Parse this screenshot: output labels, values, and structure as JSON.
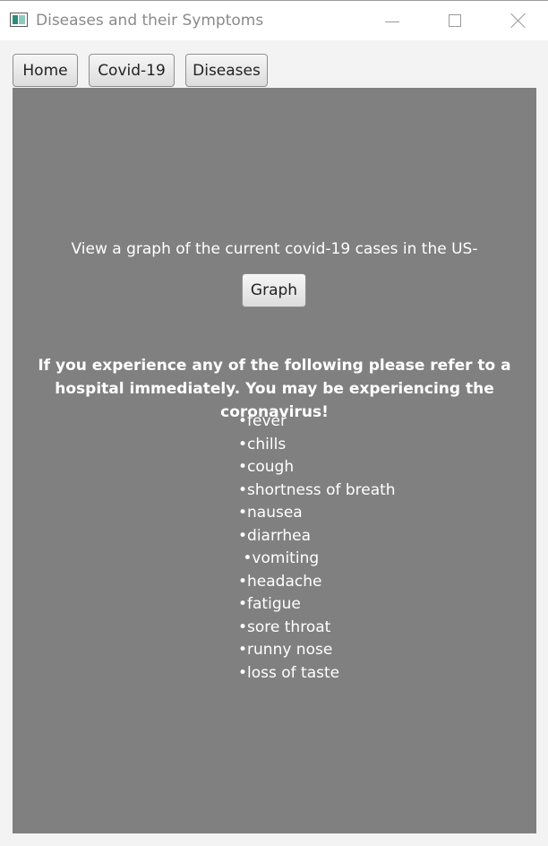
{
  "window": {
    "title": "Diseases and their Symptoms",
    "icon": "app-icon",
    "controls": [
      "minimize-icon",
      "maximize-icon",
      "close-icon"
    ]
  },
  "nav": {
    "home": "Home",
    "covid": "Covid-19",
    "diseases": "Diseases"
  },
  "main": {
    "graph_prompt": "View a graph of the current covid-19 cases in the US-",
    "graph_button": "Graph",
    "warning": "If you experience any of the following please refer to a hospital immediately. You may be experiencing the coronavirus!",
    "symptoms": [
      "•fever",
      "•chills",
      "•cough",
      "•shortness of breath",
      "•nausea",
      "•diarrhea",
      " •vomiting",
      "•headache",
      "•fatigue",
      "•sore throat",
      "•runny nose",
      "•loss of taste"
    ]
  },
  "colors": {
    "panel": "#808080",
    "window_bg": "#f3f3f3",
    "text_on_panel": "#ffffff"
  }
}
